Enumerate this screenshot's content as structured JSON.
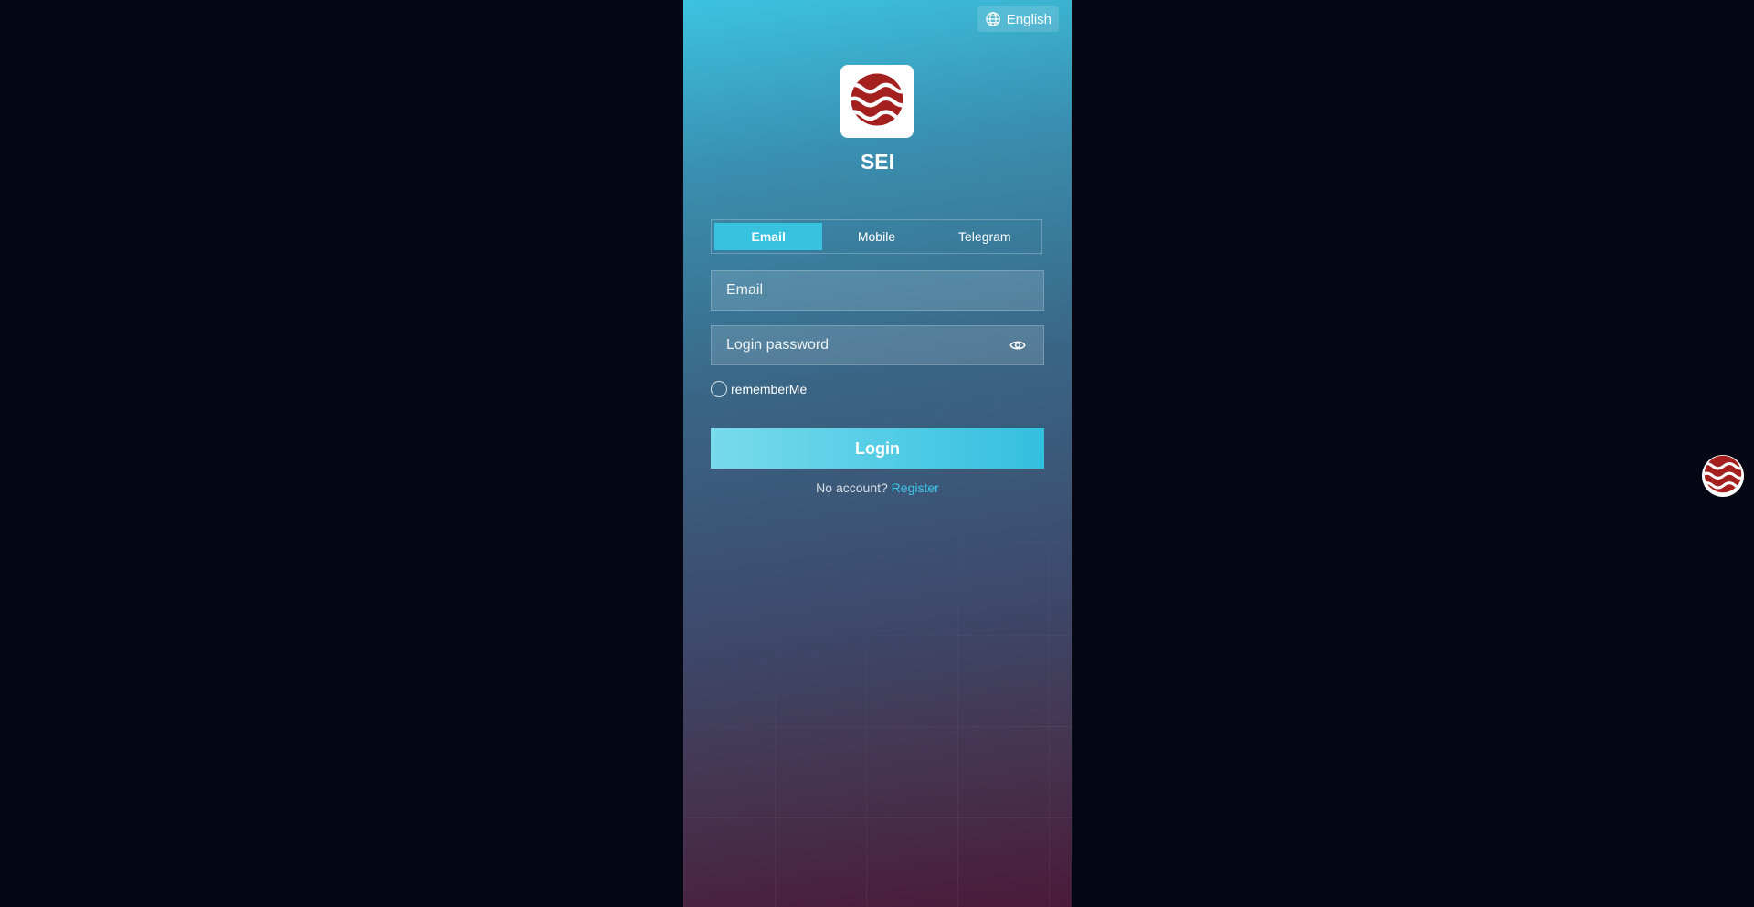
{
  "language": {
    "label": "English",
    "icon": "globe-icon"
  },
  "brand": {
    "name": "SEI",
    "logo_color": "#a3201f",
    "icon": "sei-logo-icon"
  },
  "tabs": [
    {
      "label": "Email",
      "active": true
    },
    {
      "label": "Mobile",
      "active": false
    },
    {
      "label": "Telegram",
      "active": false
    }
  ],
  "form": {
    "email_placeholder": "Email",
    "password_placeholder": "Login password",
    "password_toggle_icon": "eye-icon",
    "remember_label": "rememberMe",
    "login_label": "Login"
  },
  "signup": {
    "prompt": "No account?",
    "link": "Register"
  },
  "colors": {
    "accent": "#37c2e0",
    "link": "#3cc8ea",
    "page_bg": "#050814"
  }
}
